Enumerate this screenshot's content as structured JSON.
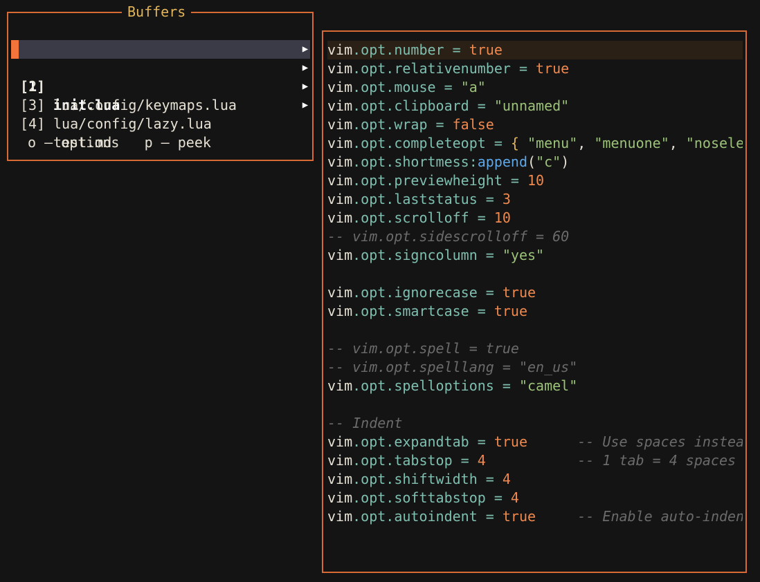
{
  "buffers": {
    "title": "Buffers",
    "items": [
      {
        "num": "[1]",
        "name": "init.lua",
        "selected": true
      },
      {
        "num": "[2]",
        "name": "lua/config/keymaps.lua",
        "selected": false
      },
      {
        "num": "[3]",
        "name": "lua/config/lazy.lua",
        "selected": false
      },
      {
        "num": "[4]",
        "name": "test.md",
        "selected": false
      }
    ],
    "arrow": "▶",
    "help": "o – options   p – peek"
  },
  "preview": {
    "lines": [
      [
        [
          "vim",
          "vim"
        ],
        [
          "dot",
          "."
        ],
        [
          "prop",
          "opt"
        ],
        [
          "dot",
          "."
        ],
        [
          "prop",
          "number"
        ],
        [
          "op",
          " = "
        ],
        [
          "bool",
          "true"
        ]
      ],
      [
        [
          "vim",
          "vim"
        ],
        [
          "dot",
          "."
        ],
        [
          "prop",
          "opt"
        ],
        [
          "dot",
          "."
        ],
        [
          "prop",
          "relativenumber"
        ],
        [
          "op",
          " = "
        ],
        [
          "bool",
          "true"
        ]
      ],
      [
        [
          "vim",
          "vim"
        ],
        [
          "dot",
          "."
        ],
        [
          "prop",
          "opt"
        ],
        [
          "dot",
          "."
        ],
        [
          "prop",
          "mouse"
        ],
        [
          "op",
          " = "
        ],
        [
          "str",
          "\"a\""
        ]
      ],
      [
        [
          "vim",
          "vim"
        ],
        [
          "dot",
          "."
        ],
        [
          "prop",
          "opt"
        ],
        [
          "dot",
          "."
        ],
        [
          "prop",
          "clipboard"
        ],
        [
          "op",
          " = "
        ],
        [
          "str",
          "\"unnamed\""
        ]
      ],
      [
        [
          "vim",
          "vim"
        ],
        [
          "dot",
          "."
        ],
        [
          "prop",
          "opt"
        ],
        [
          "dot",
          "."
        ],
        [
          "prop",
          "wrap"
        ],
        [
          "op",
          " = "
        ],
        [
          "bool",
          "false"
        ]
      ],
      [
        [
          "vim",
          "vim"
        ],
        [
          "dot",
          "."
        ],
        [
          "prop",
          "opt"
        ],
        [
          "dot",
          "."
        ],
        [
          "prop",
          "completeopt"
        ],
        [
          "op",
          " = "
        ],
        [
          "brace",
          "{ "
        ],
        [
          "str",
          "\"menu\""
        ],
        [
          "punc",
          ", "
        ],
        [
          "str",
          "\"menuone\""
        ],
        [
          "punc",
          ", "
        ],
        [
          "str",
          "\"nosele"
        ]
      ],
      [
        [
          "vim",
          "vim"
        ],
        [
          "dot",
          "."
        ],
        [
          "prop",
          "opt"
        ],
        [
          "dot",
          "."
        ],
        [
          "prop",
          "shortmess"
        ],
        [
          "dot",
          ":"
        ],
        [
          "func",
          "append"
        ],
        [
          "punc",
          "("
        ],
        [
          "str",
          "\"c\""
        ],
        [
          "punc",
          ")"
        ]
      ],
      [
        [
          "vim",
          "vim"
        ],
        [
          "dot",
          "."
        ],
        [
          "prop",
          "opt"
        ],
        [
          "dot",
          "."
        ],
        [
          "prop",
          "previewheight"
        ],
        [
          "op",
          " = "
        ],
        [
          "num",
          "10"
        ]
      ],
      [
        [
          "vim",
          "vim"
        ],
        [
          "dot",
          "."
        ],
        [
          "prop",
          "opt"
        ],
        [
          "dot",
          "."
        ],
        [
          "prop",
          "laststatus"
        ],
        [
          "op",
          " = "
        ],
        [
          "num",
          "3"
        ]
      ],
      [
        [
          "vim",
          "vim"
        ],
        [
          "dot",
          "."
        ],
        [
          "prop",
          "opt"
        ],
        [
          "dot",
          "."
        ],
        [
          "prop",
          "scrolloff"
        ],
        [
          "op",
          " = "
        ],
        [
          "num",
          "10"
        ]
      ],
      [
        [
          "comment",
          "-- vim.opt.sidescrolloff = 60"
        ]
      ],
      [
        [
          "vim",
          "vim"
        ],
        [
          "dot",
          "."
        ],
        [
          "prop",
          "opt"
        ],
        [
          "dot",
          "."
        ],
        [
          "prop",
          "signcolumn"
        ],
        [
          "op",
          " = "
        ],
        [
          "str",
          "\"yes\""
        ]
      ],
      [],
      [
        [
          "vim",
          "vim"
        ],
        [
          "dot",
          "."
        ],
        [
          "prop",
          "opt"
        ],
        [
          "dot",
          "."
        ],
        [
          "prop",
          "ignorecase"
        ],
        [
          "op",
          " = "
        ],
        [
          "bool",
          "true"
        ]
      ],
      [
        [
          "vim",
          "vim"
        ],
        [
          "dot",
          "."
        ],
        [
          "prop",
          "opt"
        ],
        [
          "dot",
          "."
        ],
        [
          "prop",
          "smartcase"
        ],
        [
          "op",
          " = "
        ],
        [
          "bool",
          "true"
        ]
      ],
      [],
      [
        [
          "comment",
          "-- vim.opt.spell = true"
        ]
      ],
      [
        [
          "comment",
          "-- vim.opt.spelllang = \"en_us\""
        ]
      ],
      [
        [
          "vim",
          "vim"
        ],
        [
          "dot",
          "."
        ],
        [
          "prop",
          "opt"
        ],
        [
          "dot",
          "."
        ],
        [
          "prop",
          "spelloptions"
        ],
        [
          "op",
          " = "
        ],
        [
          "str",
          "\"camel\""
        ]
      ],
      [],
      [
        [
          "comment",
          "-- Indent"
        ]
      ],
      [
        [
          "vim",
          "vim"
        ],
        [
          "dot",
          "."
        ],
        [
          "prop",
          "opt"
        ],
        [
          "dot",
          "."
        ],
        [
          "prop",
          "expandtab"
        ],
        [
          "op",
          " = "
        ],
        [
          "bool",
          "true"
        ],
        [
          "punc",
          "      "
        ],
        [
          "comment",
          "-- Use spaces instea"
        ]
      ],
      [
        [
          "vim",
          "vim"
        ],
        [
          "dot",
          "."
        ],
        [
          "prop",
          "opt"
        ],
        [
          "dot",
          "."
        ],
        [
          "prop",
          "tabstop"
        ],
        [
          "op",
          " = "
        ],
        [
          "num",
          "4"
        ],
        [
          "punc",
          "           "
        ],
        [
          "comment",
          "-- 1 tab = 4 spaces"
        ]
      ],
      [
        [
          "vim",
          "vim"
        ],
        [
          "dot",
          "."
        ],
        [
          "prop",
          "opt"
        ],
        [
          "dot",
          "."
        ],
        [
          "prop",
          "shiftwidth"
        ],
        [
          "op",
          " = "
        ],
        [
          "num",
          "4"
        ]
      ],
      [
        [
          "vim",
          "vim"
        ],
        [
          "dot",
          "."
        ],
        [
          "prop",
          "opt"
        ],
        [
          "dot",
          "."
        ],
        [
          "prop",
          "softtabstop"
        ],
        [
          "op",
          " = "
        ],
        [
          "num",
          "4"
        ]
      ],
      [
        [
          "vim",
          "vim"
        ],
        [
          "dot",
          "."
        ],
        [
          "prop",
          "opt"
        ],
        [
          "dot",
          "."
        ],
        [
          "prop",
          "autoindent"
        ],
        [
          "op",
          " = "
        ],
        [
          "bool",
          "true"
        ],
        [
          "punc",
          "     "
        ],
        [
          "comment",
          "-- Enable auto-inden"
        ]
      ]
    ],
    "cursor_line": 0
  },
  "colors": {
    "border": "#d86a35",
    "title": "#e3b55a",
    "background": "#141414",
    "selection": "#3b3a47",
    "marker": "#f2743a"
  }
}
